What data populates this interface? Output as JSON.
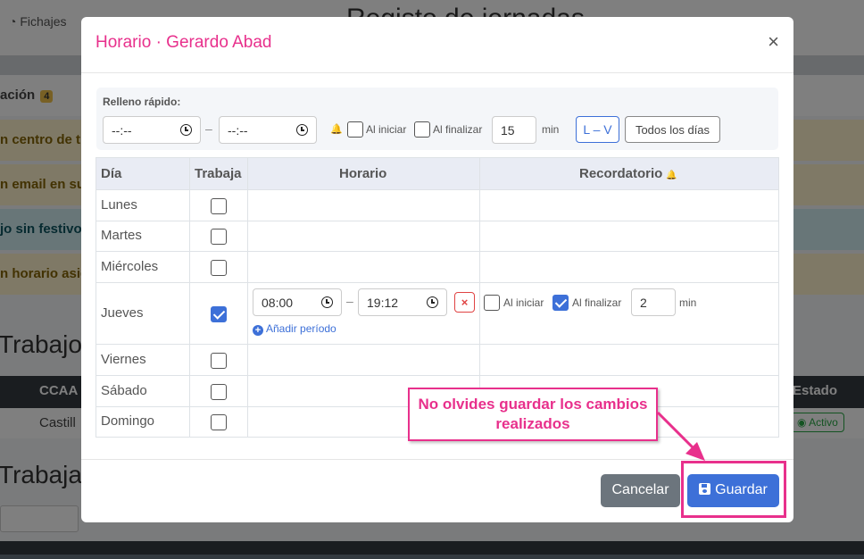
{
  "background": {
    "nav_item": "Fichajes",
    "page_title": "Registo de jornadas",
    "alert_count": "4",
    "alerts": [
      "ación",
      "n centro de tr",
      "n email en su",
      "jo sin festivo",
      "n horario asig"
    ],
    "section_titles": [
      "Trabajo",
      "Trabaja"
    ],
    "table_headers": [
      "CCAA",
      "Estado"
    ],
    "table_row": {
      "ccaa": "Castill",
      "estado": "Activo"
    }
  },
  "modal": {
    "title": "Horario · Gerardo Abad",
    "close_glyph": "×",
    "quick_fill": {
      "label": "Relleno rápido:",
      "start_placeholder": "--:--",
      "end_placeholder": "--:--",
      "separator": "–",
      "bell_glyph": "🔔",
      "al_iniciar": "Al iniciar",
      "al_finalizar": "Al finalizar",
      "minutes_value": "15",
      "min_unit": "min",
      "weekdays_button": "L – V",
      "all_days_button": "Todos los días"
    },
    "table": {
      "headers": {
        "day": "Día",
        "works": "Trabaja",
        "schedule": "Horario",
        "reminder": "Recordatorio"
      },
      "days": [
        {
          "name": "Lunes",
          "works": false
        },
        {
          "name": "Martes",
          "works": false
        },
        {
          "name": "Miércoles",
          "works": false
        },
        {
          "name": "Jueves",
          "works": true
        },
        {
          "name": "Viernes",
          "works": false
        },
        {
          "name": "Sábado",
          "works": false
        },
        {
          "name": "Domingo",
          "works": false
        }
      ],
      "thursday": {
        "start": "08:00",
        "end": "19:12",
        "separator": "–",
        "remove_glyph": "×",
        "add_period": "Añadir período",
        "al_iniciar": "Al iniciar",
        "al_iniciar_checked": false,
        "al_finalizar": "Al finalizar",
        "al_finalizar_checked": true,
        "minutes_value": "2",
        "min_unit": "min"
      }
    },
    "footer": {
      "cancel_label": "Cancelar",
      "save_label": "Guardar"
    }
  },
  "annotation": {
    "text": "No olvides guardar los cambios realizados",
    "color": "#e8308c"
  },
  "colors": {
    "accent_pink": "#e8308c",
    "primary_blue": "#3d70d8",
    "cancel_gray": "#6c757d",
    "danger_red": "#e04343"
  }
}
